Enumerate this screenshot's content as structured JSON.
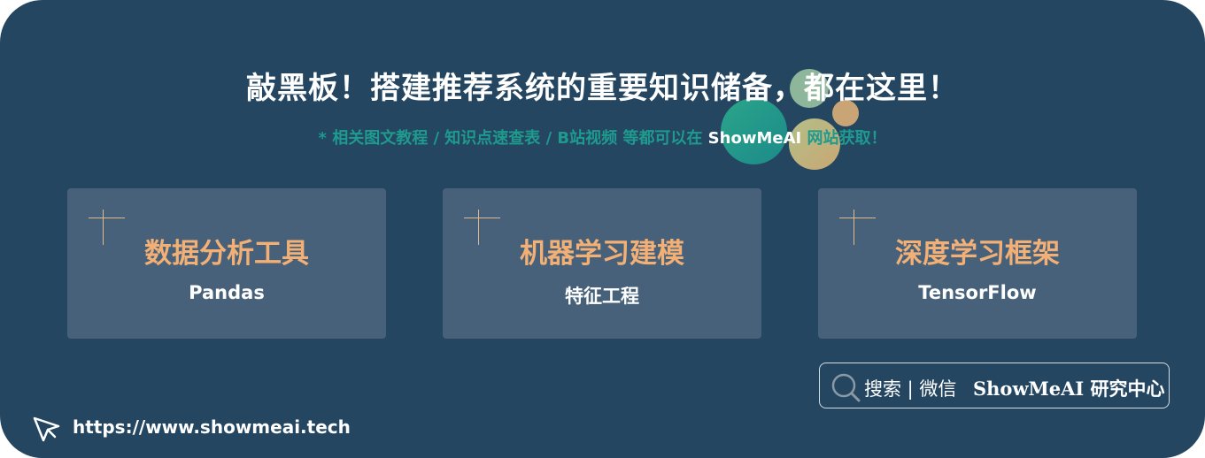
{
  "header": {
    "title": "敲黑板！搭建推荐系统的重要知识储备，都在这里！",
    "subtitle_before": "* 相关图文教程 / 知识点速查表 / B站视频 等都可以在 ",
    "subtitle_brand": "ShowMeAI",
    "subtitle_after": " 网站获取！"
  },
  "cards": [
    {
      "title": "数据分析工具",
      "subtitle": "Pandas"
    },
    {
      "title": "机器学习建模",
      "subtitle": "特征工程"
    },
    {
      "title": "深度学习框架",
      "subtitle": "TensorFlow"
    }
  ],
  "search": {
    "label": "搜索 | 微信",
    "brand": "ShowMeAI 研究中心",
    "icon": "search-icon"
  },
  "footer": {
    "url": "https://www.showmeai.tech",
    "icon": "cursor-icon"
  },
  "colors": {
    "background": "#244661",
    "card": "#466179",
    "card_title": "#f2b076",
    "subtitle_teal": "#1e9a8e",
    "accent_line": "#e2b98c"
  }
}
